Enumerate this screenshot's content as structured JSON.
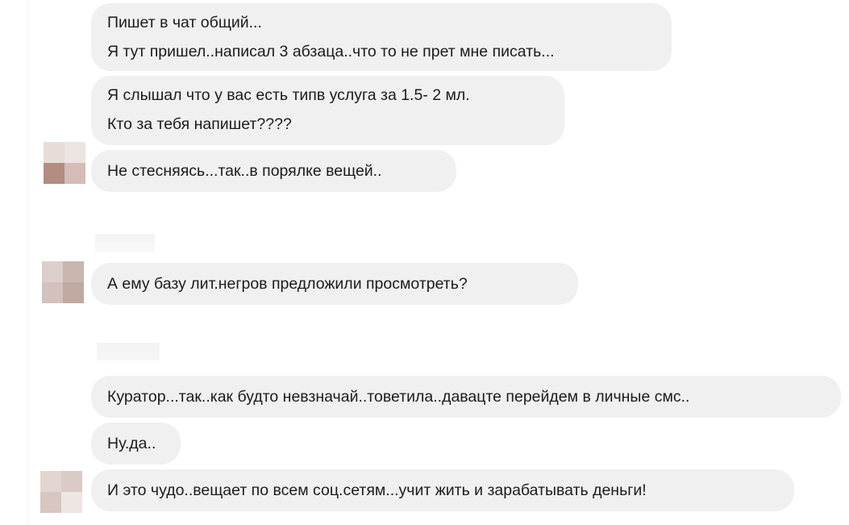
{
  "messages": [
    {
      "lines": [
        "Пишет в чат общий...",
        "Я тут пришел..написал 3 абзаца..что то не прет мне писать..."
      ]
    },
    {
      "lines": [
        "Я слышал что у вас есть типв услуга за 1.5- 2 мл.",
        "Кто за тебя напишет????"
      ]
    },
    {
      "lines": [
        "Не стесняясь...так..в порялке вещей.."
      ]
    },
    {
      "lines": [
        "А ему базу лит.негров предложили просмотреть?"
      ]
    },
    {
      "lines": [
        "Куратор...так..как будто невзначай..товетила..давацте перейдем в личные смс.."
      ]
    },
    {
      "lines": [
        "Ну.да.."
      ]
    },
    {
      "lines": [
        "И это чудо..вещает по всем соц.сетям...учит жить и зарабатывать деньги!"
      ]
    }
  ],
  "colors": {
    "bubble_background": "#f0f0f0",
    "text": "#1c1c1c",
    "page_background": "#ffffff"
  }
}
